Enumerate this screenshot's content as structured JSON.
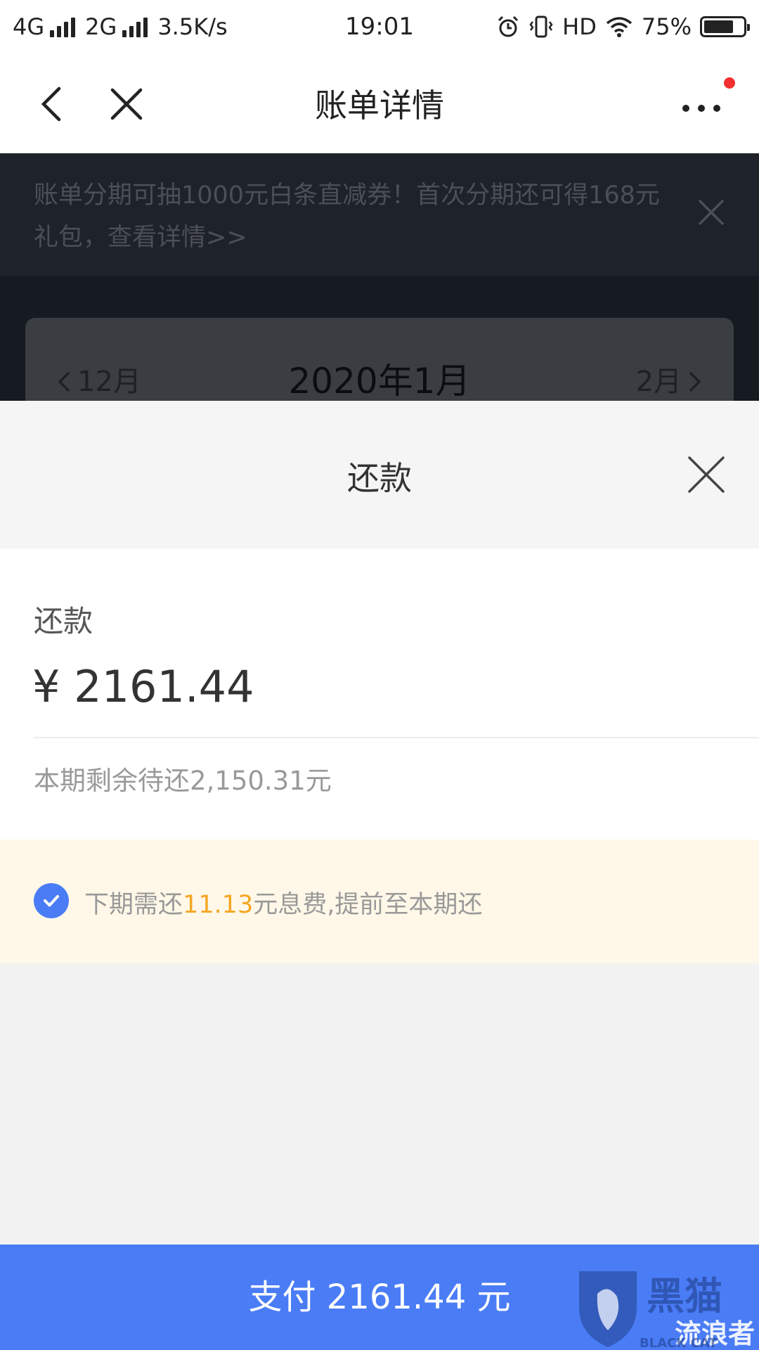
{
  "status_bar": {
    "network_1": "4G",
    "network_2": "2G",
    "speed": "3.5K/s",
    "time": "19:01",
    "hd_label": "HD",
    "battery_percent": "75%",
    "battery_level": 0.75
  },
  "nav": {
    "title": "账单详情",
    "back_icon": "chevron-left-icon",
    "close_icon": "close-icon",
    "more_icon": "more-icon",
    "has_notification_dot": true
  },
  "banner": {
    "text": "账单分期可抽1000元白条直减券！首次分期还可得168元礼包，查看详情>>"
  },
  "month_switcher": {
    "prev_label": "12月",
    "current_label": "2020年1月",
    "next_label": "2月"
  },
  "sheet": {
    "title": "还款"
  },
  "amount": {
    "label": "还款",
    "value": "¥ 2161.44",
    "remaining_text": "本期剩余待还2,150.31元"
  },
  "notice": {
    "prefix": "下期需还",
    "highlight": "11.13",
    "suffix": "元息费,提前至本期还",
    "checked": true
  },
  "pay_button": {
    "label": "支付 2161.44 元"
  },
  "watermark": {
    "text_main": "黑猫",
    "text_sub": "流浪者",
    "text_small": "BLACK CAT"
  },
  "colors": {
    "primary_blue": "#4a7cf6",
    "highlight_orange": "#f5a623",
    "notice_bg": "#fff8e8",
    "notification_red": "#f23030"
  }
}
